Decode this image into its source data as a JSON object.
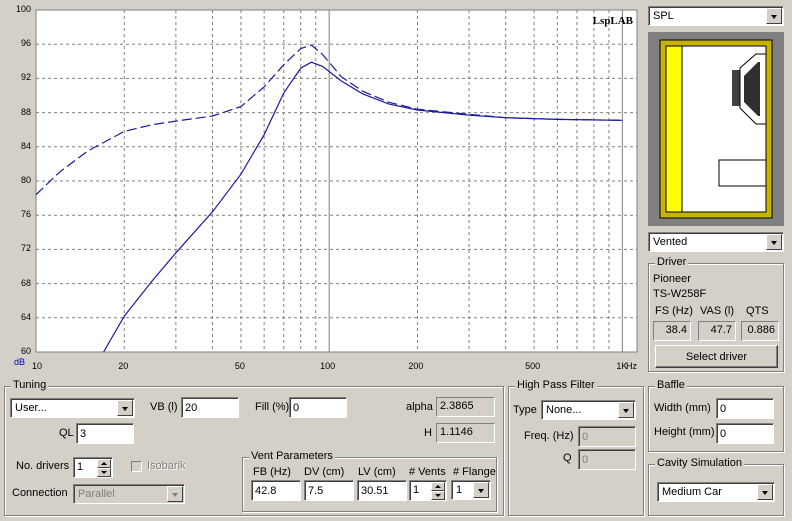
{
  "chart_data": {
    "type": "line",
    "brand": "LspLAB",
    "y_unit": "dB",
    "x_unit": "Hz",
    "x_scale": "log",
    "xlim": [
      10,
      1000
    ],
    "ylim": [
      60,
      100
    ],
    "grid": true,
    "y_ticks": [
      "100",
      "96",
      "92",
      "88",
      "84",
      "80",
      "76",
      "72",
      "68",
      "64",
      "60"
    ],
    "x_ticks": [
      {
        "v": 10,
        "t": "10"
      },
      {
        "v": 20,
        "t": "20"
      },
      {
        "v": 50,
        "t": "50"
      },
      {
        "v": 100,
        "t": "100"
      },
      {
        "v": 200,
        "t": "200"
      },
      {
        "v": 500,
        "t": "500"
      },
      {
        "v": 1000,
        "t": "1K"
      }
    ],
    "series": [
      {
        "style": "solid",
        "color": "#1a1aa0",
        "x": [
          17,
          20,
          25,
          30,
          40,
          50,
          60,
          70,
          80,
          87,
          95,
          110,
          130,
          160,
          200,
          300,
          400,
          600,
          1000
        ],
        "y": [
          60,
          64.2,
          68.4,
          71.6,
          76.4,
          80.8,
          85.4,
          90.3,
          93.2,
          93.9,
          93.4,
          91.7,
          90.2,
          89.0,
          88.3,
          87.7,
          87.4,
          87.2,
          87.1
        ]
      },
      {
        "style": "dashed",
        "color": "#1a1aa0",
        "x": [
          10,
          12,
          15,
          20,
          25,
          30,
          40,
          50,
          60,
          70,
          80,
          87,
          95,
          110,
          130,
          160,
          200,
          300,
          400,
          600,
          1000
        ],
        "y": [
          78.4,
          81.0,
          83.5,
          85.8,
          86.6,
          87.0,
          87.6,
          88.7,
          91.0,
          93.6,
          95.5,
          95.9,
          94.8,
          92.2,
          90.5,
          89.2,
          88.4,
          87.8,
          87.4,
          87.2,
          87.1
        ]
      }
    ]
  },
  "right": {
    "view_combo": "SPL",
    "box_type_combo": "Vented",
    "driver_group_label": "Driver",
    "driver_brand": "Pioneer",
    "driver_model": "TS-W258F",
    "fs_label": "FS (Hz)",
    "vas_label": "VAS (l)",
    "qts_label": "QTS",
    "fs_value": "38.4",
    "vas_value": "47.7",
    "qts_value": "0.886",
    "select_driver_label": "Select driver"
  },
  "tuning": {
    "group_label": "Tuning",
    "alignment_combo": "User...",
    "vb_label": "VB (l)",
    "vb_value": "20",
    "fill_label": "Fill (%)",
    "fill_value": "0",
    "alpha_label": "alpha",
    "alpha_value": "2.3865",
    "ql_label": "QL",
    "ql_value": "3",
    "h_label": "H",
    "h_value": "1.1146",
    "drivers_label": "No. drivers",
    "drivers_value": "1",
    "isobarik_label": "Isobarik",
    "connection_label": "Connection",
    "connection_value": "Parallel"
  },
  "vent": {
    "group_label": "Vent Parameters",
    "fb_label": "FB (Hz)",
    "dv_label": "DV (cm)",
    "lv_label": "LV (cm)",
    "vents_label": "# Vents",
    "flange_label": "# Flange",
    "fb_value": "42.8",
    "dv_value": "7.5",
    "lv_value": "30.51",
    "vents_value": "1",
    "flange_value": "1"
  },
  "hpf": {
    "group_label": "High Pass Filter",
    "type_label": "Type",
    "type_value": "None...",
    "freq_label": "Freq. (Hz)",
    "freq_value": "0",
    "q_label": "Q",
    "q_value": "0"
  },
  "baffle": {
    "group_label": "Baffle",
    "width_label": "Width (mm)",
    "width_value": "0",
    "height_label": "Height (mm)",
    "height_value": "0"
  },
  "cavity": {
    "group_label": "Cavity Simulation",
    "value": "Medium Car"
  }
}
